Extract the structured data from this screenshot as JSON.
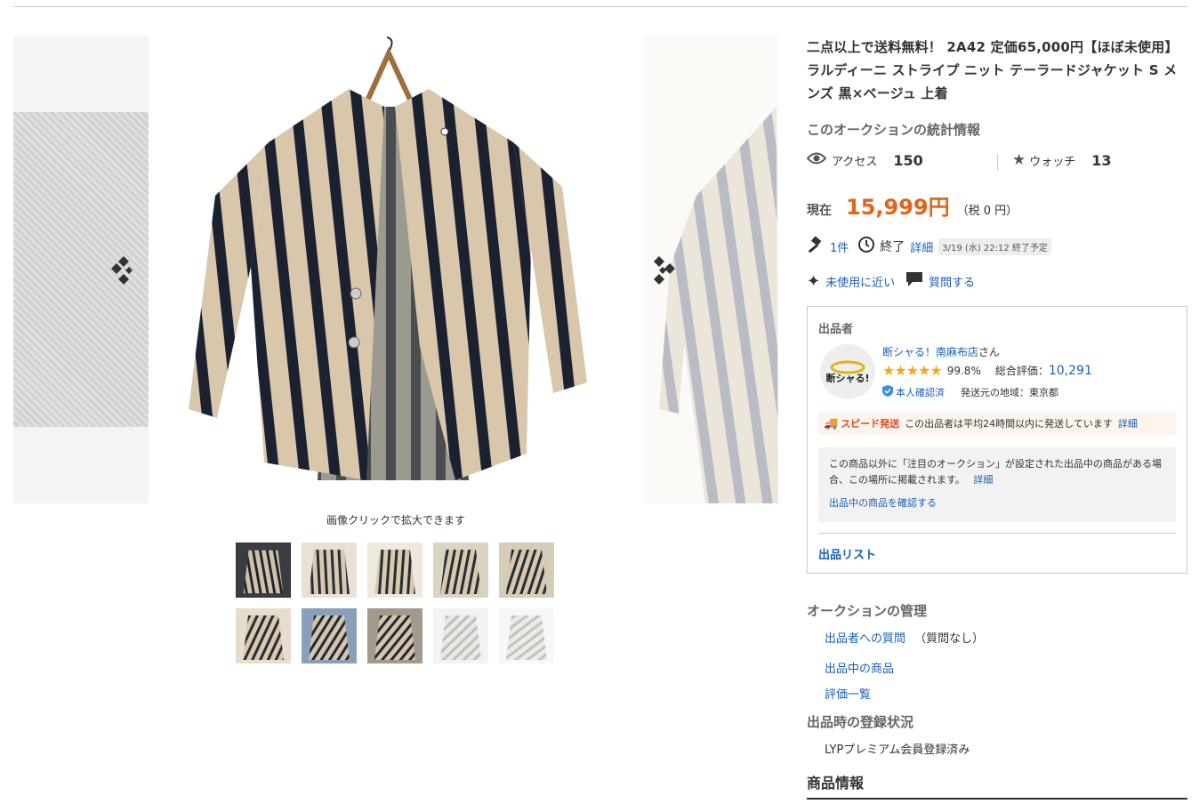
{
  "item": {
    "title": "二点以上で送料無料！ 2A42 定価65,000円【ほぼ未使用】ラルディーニ ストライプ ニット テーラードジャケット S メンズ 黒×ベージュ 上着"
  },
  "gallery": {
    "caption": "画像クリックで拡大できます",
    "thumbnail_count": 10
  },
  "stats": {
    "heading": "このオークションの統計情報",
    "access_label": "アクセス",
    "access_value": "150",
    "watch_label": "ウォッチ",
    "watch_value": "13"
  },
  "price": {
    "label": "現在",
    "amount": "15,999円",
    "tax": "（税 0 円）"
  },
  "bids": {
    "count": "1件",
    "status": "終了",
    "detail_link": "詳細",
    "end_time": "3/19 (水) 22:12 終了予定"
  },
  "condition": {
    "label": "未使用に近い",
    "ask_question": "質問する"
  },
  "seller": {
    "heading": "出品者",
    "avatar_text": "断シャる!",
    "name": "断シャる！南麻布店",
    "name_suffix": "さん",
    "rating_percent": "99.8%",
    "total_rating_label": "総合評価：",
    "total_rating_value": "10,291",
    "verified": "本人確認済",
    "ship_from": "発送元の地域：東京都",
    "speed_tag": "スピード発送",
    "speed_text": "この出品者は平均24時間以内に発送しています",
    "speed_detail": "詳細",
    "notice_text": "この商品以外に「注目のオークション」が設定された出品中の商品がある場合、この場所に掲載されます。",
    "notice_detail": "詳細",
    "notice_link": "出品中の商品を確認する",
    "list_link": "出品リスト"
  },
  "management": {
    "heading": "オークションの管理",
    "question_link": "出品者への質問",
    "question_note": "（質問なし）",
    "items_link": "出品中の商品",
    "ratings_link": "評価一覧"
  },
  "registration": {
    "heading": "出品時の登録状況",
    "value": "LYPプレミアム会員登録済み"
  },
  "product_info": {
    "heading": "商品情報"
  },
  "colors": {
    "price": "#e2641b",
    "link": "#1a5fb4",
    "star": "#f5a623",
    "speed": "#e8471f"
  }
}
